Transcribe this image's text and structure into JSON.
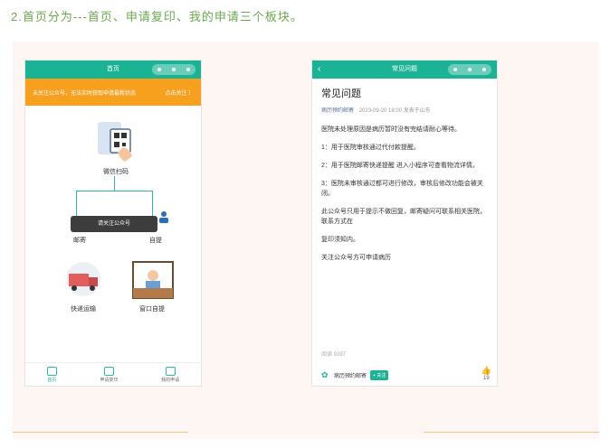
{
  "heading": "2.首页分为---首页、申请复印、我的申请三个板块。",
  "phone1": {
    "title": "首页",
    "notice": "未关注公众号，无法实时获取申请最新状态",
    "notice_action": "点击关注 〉",
    "scan_label": "微信扫码",
    "tooltip": "请关注公众号",
    "mail_label": "邮寄",
    "self_label": "自提",
    "express_label": "快递运输",
    "window_label": "窗口自提",
    "tabs": [
      "首页",
      "申请复印",
      "我的申请"
    ]
  },
  "phone2": {
    "title": "常见问题",
    "article_title": "常见问题",
    "source": "病历预约邮寄",
    "datetime": "2023-09-20 18:00",
    "location": "发表于山东",
    "paragraphs": [
      "医院未处理原因是病历暂时没有完结请耐心等待。",
      "1：用于医院审核通过代付款提醒。",
      "2：用于医院邮寄快递提醒 进入小程序可查看物流详情。",
      "3：医院未审核通过都可进行修改，审核后修改功能会被关闭。",
      "此公众号只用于提示不做回复，邮寄疑问可联系相关医院，联系方式在",
      "复印须知内。",
      "关注公众号方可申请病历"
    ],
    "read": "阅读 9297",
    "footer_name": "病历预约邮寄",
    "follow": "+ 关注",
    "likes": "19"
  },
  "colors": {
    "accent": "#1ab394",
    "notice": "#f7a01d",
    "heading": "#6aa84f"
  }
}
